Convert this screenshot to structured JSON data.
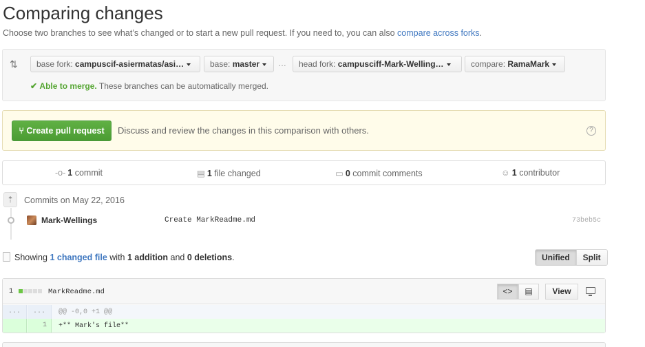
{
  "page": {
    "title": "Comparing changes",
    "subtitle_text": "Choose two branches to see what’s changed or to start a new pull request. If you need to, you can also ",
    "subtitle_link": "compare across forks",
    "subtitle_end": "."
  },
  "range": {
    "base_fork_key": "base fork:",
    "base_fork_value": "campuscif-asiermatas/asi…",
    "base_key": "base:",
    "base_value": "master",
    "ellipsis": "…",
    "head_fork_key": "head fork:",
    "head_fork_value": "campusciff-Mark-Welling…",
    "compare_key": "compare:",
    "compare_value": "RamaMark",
    "merge_status": "Able to merge.",
    "merge_detail": " These branches can be automatically merged."
  },
  "pull_request": {
    "button_label": "Create pull request",
    "description": "Discuss and review the changes in this comparison with others.",
    "help": "?"
  },
  "stats": {
    "commits_count": "1",
    "commits_label": " commit",
    "files_count": "1",
    "files_label": " file changed",
    "comments_count": "0",
    "comments_label": " commit comments",
    "contributors_count": "1",
    "contributors_label": " contributor"
  },
  "commits": {
    "group_label": "Commits on May 22, 2016",
    "items": [
      {
        "author": "Mark-Wellings",
        "message": "Create MarkReadme.md",
        "sha": "73beb5c"
      }
    ]
  },
  "files_summary": {
    "prefix": "Showing ",
    "changed_link": "1 changed file",
    "middle": " with ",
    "additions": "1 addition",
    "and": " and ",
    "deletions": "0 deletions",
    "end": ".",
    "unified_label": "Unified",
    "split_label": "Split"
  },
  "file": {
    "count": "1",
    "diffstat": {
      "added_blocks": 1,
      "total_blocks": 5
    },
    "name": "MarkReadme.md",
    "view_label": "View",
    "hunk_left": "...",
    "hunk_right": "...",
    "hunk_header": "@@ -0,0 +1 @@",
    "lines": [
      {
        "old": "",
        "new": "1",
        "text": "+** Mark's file**"
      }
    ]
  },
  "colors": {
    "link": "#4078c0",
    "success": "#55a532",
    "pr_button": "#55a532",
    "addition_bg": "#eaffea"
  }
}
